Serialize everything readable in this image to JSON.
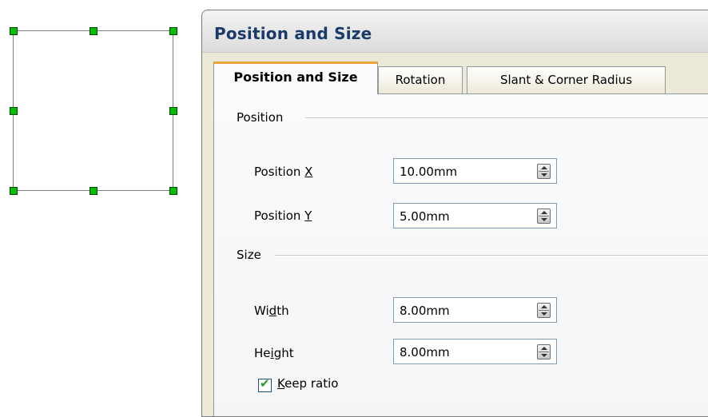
{
  "canvas": {
    "selected_shape": "square",
    "handle_color": "#00c000"
  },
  "dialog": {
    "title": "Position and Size",
    "tabs": [
      {
        "label": "Position and Size",
        "active": true
      },
      {
        "label": "Rotation",
        "active": false
      },
      {
        "label": "Slant & Corner Radius",
        "active": false
      }
    ],
    "position_group": {
      "label": "Position",
      "x": {
        "label_pre": "Position ",
        "label_key": "X",
        "label_post": "",
        "value": "10.00mm"
      },
      "y": {
        "label_pre": "Position ",
        "label_key": "Y",
        "label_post": "",
        "value": "5.00mm"
      }
    },
    "size_group": {
      "label": "Size",
      "width": {
        "label_pre": "Wi",
        "label_key": "d",
        "label_post": "th",
        "value": "8.00mm"
      },
      "height": {
        "label_pre": "He",
        "label_key": "i",
        "label_post": "ght",
        "value": "8.00mm"
      },
      "keep_ratio": {
        "label_key": "K",
        "label_post": "eep ratio",
        "checked": true
      }
    },
    "colors": {
      "active_tab_accent": "#e8a33b",
      "title_color": "#1a3a6a",
      "check_color": "#21a121"
    }
  }
}
